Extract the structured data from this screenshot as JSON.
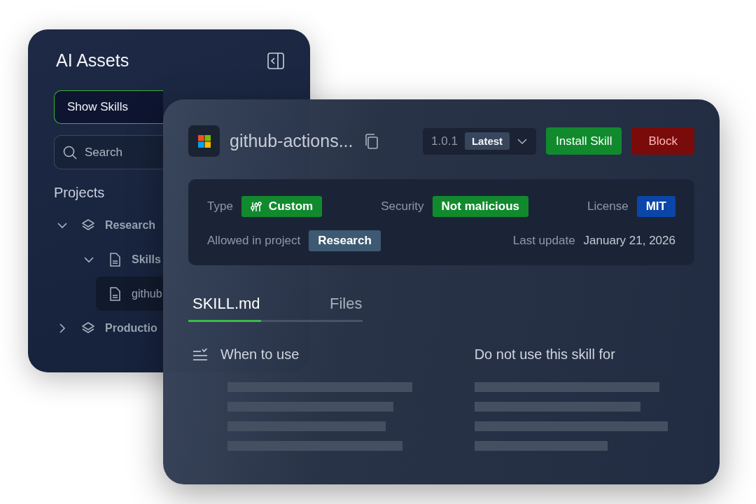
{
  "sidebar": {
    "title": "AI Assets",
    "filter": {
      "value": "Show Skills"
    },
    "search": {
      "placeholder": "Search"
    },
    "section_title": "Projects",
    "tree": [
      {
        "label": "Research",
        "kind": "project",
        "expanded": true,
        "selected": false,
        "children": [
          {
            "label": "Skills",
            "kind": "folder",
            "expanded": true,
            "selected": false,
            "children": [
              {
                "label": "github",
                "kind": "file",
                "selected": true
              }
            ]
          }
        ]
      },
      {
        "label": "Productio",
        "kind": "project",
        "expanded": false,
        "selected": false
      }
    ]
  },
  "skill": {
    "name": "github-actions...",
    "version": "1.0.1",
    "version_tag": "Latest",
    "buttons": [
      {
        "label": "Install Skill",
        "kind": "install"
      },
      {
        "label": "Block",
        "kind": "block"
      }
    ],
    "details": [
      [
        {
          "label": "Type",
          "value": "Custom",
          "kind": "badge",
          "color": "#118a2e",
          "icon": true
        },
        {
          "label": "Security",
          "value": "Not malicious",
          "kind": "badge",
          "color": "#118a2e"
        },
        {
          "label": "License",
          "value": "MIT",
          "kind": "badge",
          "color": "#0a45a8"
        }
      ],
      [
        {
          "label": "Allowed in project",
          "value": "Research",
          "kind": "badge",
          "color": "#3d5a72"
        },
        {
          "label": "Last update",
          "value": "January 21, 2026",
          "kind": "text"
        }
      ]
    ],
    "tabs": [
      {
        "label": "SKILL.md",
        "selected": true
      },
      {
        "label": "Files",
        "selected": false
      }
    ],
    "sections": [
      {
        "title": "When to use",
        "kind": "checklist"
      },
      {
        "title": "Do not use this skill for",
        "kind": "plain"
      }
    ]
  }
}
